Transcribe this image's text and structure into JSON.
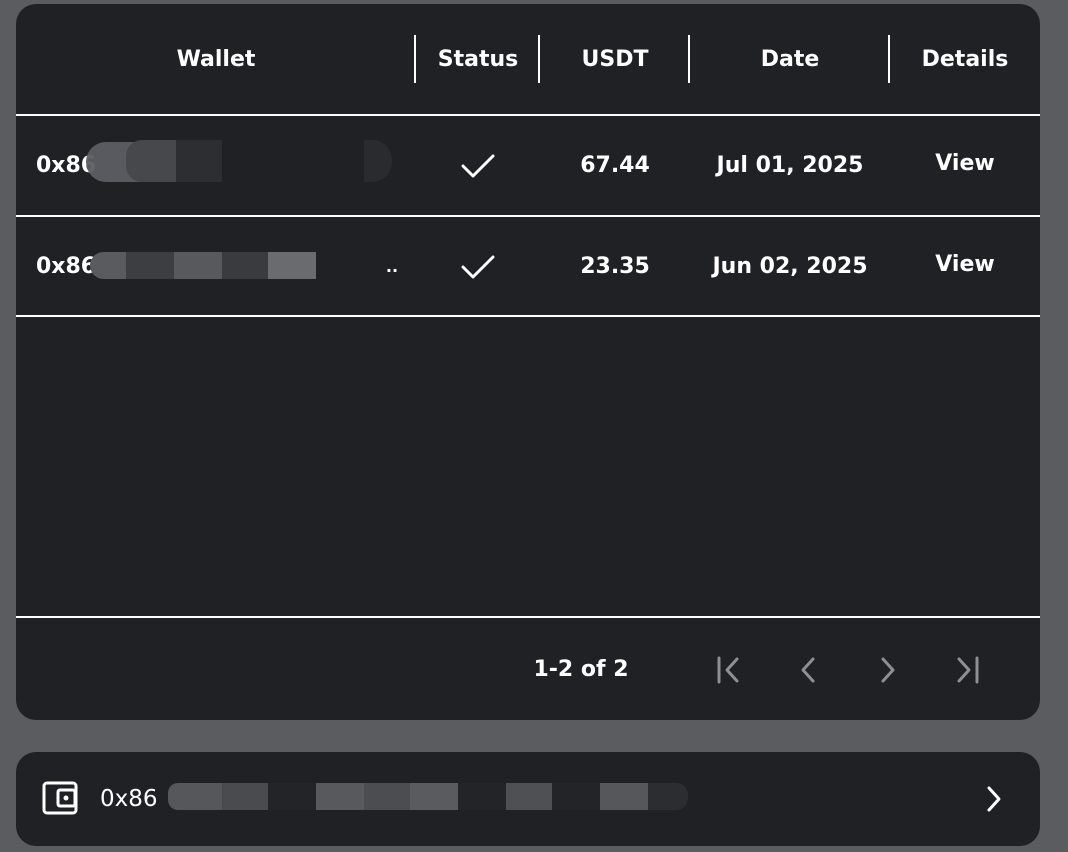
{
  "table": {
    "headers": {
      "wallet": "Wallet",
      "status": "Status",
      "usdt": "USDT",
      "date": "Date",
      "details": "Details"
    },
    "rows": [
      {
        "wallet_prefix": "0x86",
        "wallet_suffix": "",
        "usdt": "67.44",
        "date": "Jul 01, 2025",
        "details": "View"
      },
      {
        "wallet_prefix": "0x86",
        "wallet_suffix": "..",
        "usdt": "23.35",
        "date": "Jun 02, 2025",
        "details": "View"
      }
    ]
  },
  "pagination": {
    "range_text": "1-2 of 2"
  },
  "wallet_bar": {
    "address_prefix": "0x86"
  },
  "icons": {
    "status": "check-icon",
    "first_page": "first-page-icon",
    "prev_page": "chevron-left-icon",
    "next_page": "chevron-right-icon",
    "last_page": "last-page-icon",
    "wallet": "wallet-icon",
    "open": "chevron-right-icon"
  },
  "colors": {
    "background": "#5b5c60",
    "card": "#202125",
    "text": "#ffffff",
    "disabled_icon": "#8e8f93"
  }
}
